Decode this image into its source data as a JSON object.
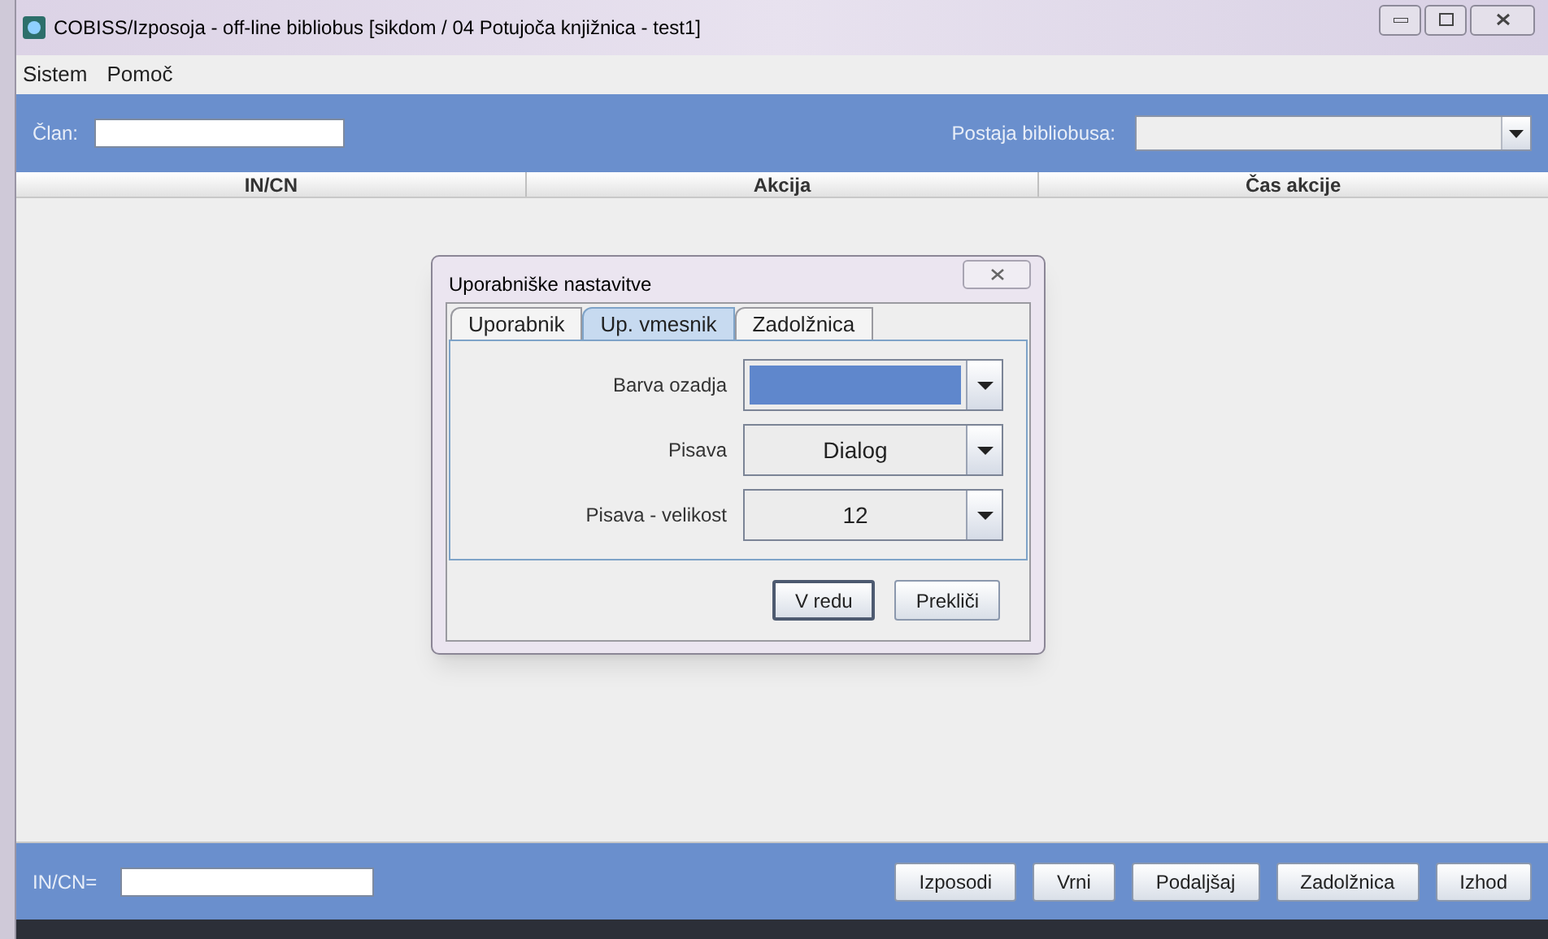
{
  "window": {
    "title": "COBISS/Izposoja - off-line bibliobus [sikdom / 04 Potujoča knjižnica - test1]"
  },
  "menu": [
    "Sistem",
    "Pomoč"
  ],
  "top_panel": {
    "member_label": "Član:",
    "station_label": "Postaja bibliobusa:"
  },
  "table": {
    "columns": [
      "IN/CN",
      "Akcija",
      "Čas akcije"
    ]
  },
  "dialog": {
    "title": "Uporabniške nastavitve",
    "tabs": [
      {
        "label": "Uporabnik",
        "selected": false
      },
      {
        "label": "Up. vmesnik",
        "selected": true
      },
      {
        "label": "Zadolžnica",
        "selected": false
      }
    ],
    "fields": [
      {
        "label": "Barva ozadja",
        "kind": "color",
        "color": "#5f87cc"
      },
      {
        "label": "Pisava",
        "kind": "text",
        "value": "Dialog"
      },
      {
        "label": "Pisava - velikost",
        "kind": "text",
        "value": "12"
      }
    ],
    "buttons": [
      "V redu",
      "Prekliči"
    ]
  },
  "bottom": {
    "incn_label": "IN/CN=",
    "buttons": [
      "Izposodi",
      "Vrni",
      "Podaljšaj",
      "Zadolžnica",
      "Izhod"
    ]
  }
}
